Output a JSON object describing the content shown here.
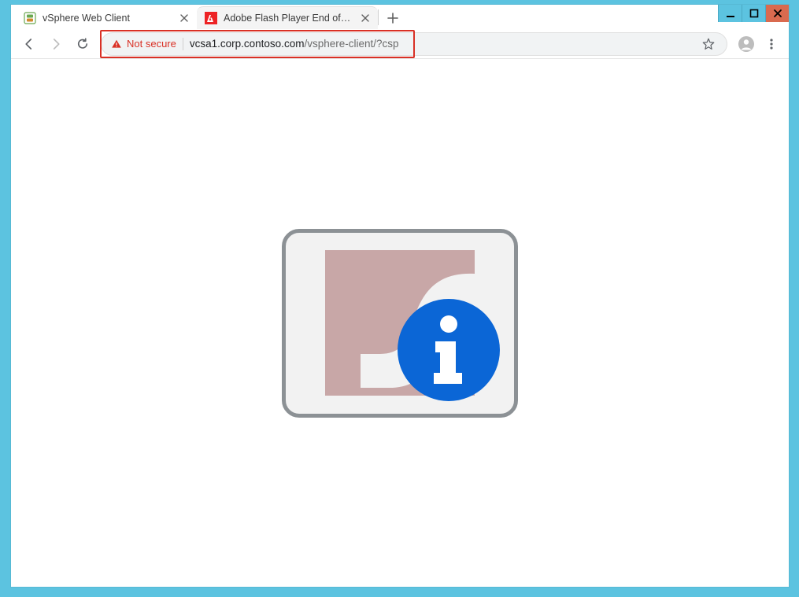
{
  "window": {
    "controls": {
      "minimize": "minimize",
      "maximize": "maximize",
      "close": "close"
    }
  },
  "tabs": [
    {
      "title": "vSphere Web Client",
      "favicon": "vsphere-icon",
      "active": true
    },
    {
      "title": "Adobe Flash Player End of Life",
      "favicon": "adobe-icon",
      "active": false
    }
  ],
  "toolbar": {
    "back": "back",
    "forward": "forward",
    "reload": "reload",
    "security_label": "Not secure",
    "url_host": "vcsa1.corp.contoso.com",
    "url_path": "/vsphere-client/?csp",
    "star": "bookmark",
    "profile": "profile",
    "menu": "menu"
  },
  "content": {
    "flash_icon": "flash-logo",
    "info_badge": "info"
  }
}
